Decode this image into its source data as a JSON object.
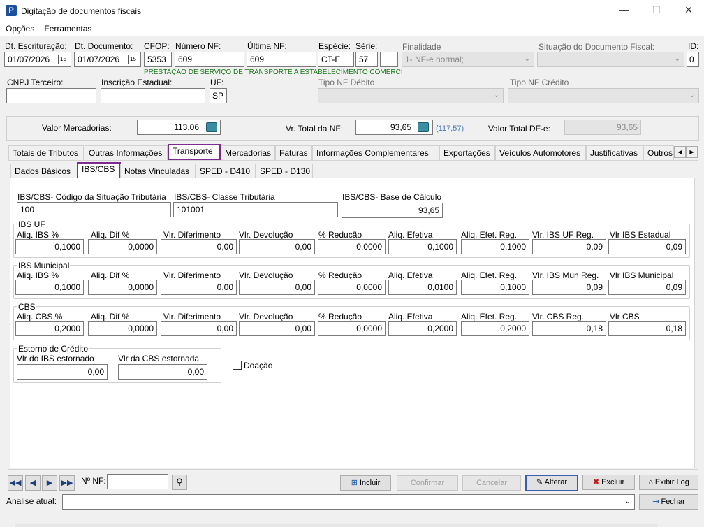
{
  "window": {
    "title": "Digitação de documentos fiscais"
  },
  "menu": [
    "Opções",
    "Ferramentas"
  ],
  "header": {
    "dt_escrituracao": {
      "label": "Dt. Escrituração:",
      "value": "01/07/2026"
    },
    "dt_documento": {
      "label": "Dt. Documento:",
      "value": "01/07/2026"
    },
    "cfop": {
      "label": "CFOP:",
      "value": "5353",
      "description": "PRESTAÇÃO DE SERVIÇO DE TRANSPORTE A ESTABELECIMENTO COMERCI"
    },
    "numero_nf": {
      "label": "Número NF:",
      "value": "609"
    },
    "ultima_nf": {
      "label": "Última NF:",
      "value": "609"
    },
    "especie": {
      "label": "Espécie:",
      "value": "CT-E"
    },
    "serie": {
      "label": "Série:",
      "value": "57",
      "extra": ""
    },
    "finalidade": {
      "label": "Finalidade",
      "value": "1- NF-e normal;"
    },
    "situacao": {
      "label": "Situação do Documento Fiscal:",
      "value": ""
    },
    "id": {
      "label": "ID:",
      "value": "0"
    },
    "cnpj": {
      "label": "CNPJ Terceiro:",
      "value": ""
    },
    "ie": {
      "label": "Inscrição Estadual:",
      "value": ""
    },
    "uf": {
      "label": "UF:",
      "value": "SP"
    },
    "tipo_debito": {
      "label": "Tipo NF Débito",
      "value": ""
    },
    "tipo_credito": {
      "label": "Tipo NF Crédito",
      "value": ""
    }
  },
  "totals": {
    "valor_mercadorias": {
      "label": "Valor Mercadorias:",
      "value": "113,06"
    },
    "vr_total_nf": {
      "label": "Vr. Total da NF:",
      "value": "93,65",
      "hint": "(117,57)"
    },
    "valor_total_dfe": {
      "label": "Valor Total DF-e:",
      "value": "93,65"
    }
  },
  "tabs": [
    "Totais de Tributos",
    "Outras Informações",
    "Transporte",
    "Mercadorias",
    "Faturas",
    "Informações Complementares",
    "Exportações",
    "Veículos Automotores",
    "Justificativas",
    "Outros"
  ],
  "subtabs": [
    "Dados Básicos",
    "IBS/CBS",
    "Notas Vinculadas",
    "SPED - D410",
    "SPED - D130"
  ],
  "ibscbs": {
    "cst": {
      "label": "IBS/CBS- Código da Situação Tributária",
      "value": "100"
    },
    "classe": {
      "label": "IBS/CBS- Classe Tributária",
      "value": "101001"
    },
    "base": {
      "label": "IBS/CBS- Base de Cálculo",
      "value": "93,65"
    }
  },
  "ibs_uf": {
    "title": "IBS UF",
    "labels": [
      "Aliq. IBS %",
      "Aliq. Dif %",
      "Vlr. Diferimento",
      "Vlr. Devolução",
      "% Redução",
      "Aliq. Efetiva",
      "Aliq. Efet. Reg.",
      "Vlr. IBS UF Reg.",
      "Vlr IBS Estadual"
    ],
    "values": [
      "0,1000",
      "0,0000",
      "0,00",
      "0,00",
      "0,0000",
      "0,1000",
      "0,1000",
      "0,09",
      "0,09"
    ]
  },
  "ibs_mun": {
    "title": "IBS Municipal",
    "labels": [
      "Aliq. IBS %",
      "Aliq. Dif %",
      "Vlr. Diferimento",
      "Vlr. Devolução",
      "% Redução",
      "Aliq. Efetiva",
      "Aliq. Efet. Reg.",
      "Vlr. IBS Mun Reg.",
      "Vlr IBS Municipal"
    ],
    "values": [
      "0,1000",
      "0,0000",
      "0,00",
      "0,00",
      "0,0000",
      "0,0100",
      "0,1000",
      "0,09",
      "0,09"
    ]
  },
  "cbs": {
    "title": "CBS",
    "labels": [
      "Aliq. CBS %",
      "Aliq. Dif %",
      "Vlr. Diferimento",
      "Vlr. Devolução",
      "% Redução",
      "Aliq. Efetiva",
      "Aliq. Efet. Reg.",
      "Vlr. CBS Reg.",
      "Vlr CBS"
    ],
    "values": [
      "0,2000",
      "0,0000",
      "0,00",
      "0,00",
      "0,0000",
      "0,2000",
      "0,2000",
      "0,18",
      "0,18"
    ]
  },
  "estorno": {
    "title": "Estorno de Crédito",
    "ibs_label": "Vlr do IBS estornado",
    "ibs_value": "0,00",
    "cbs_label": "Vlr da CBS estornada",
    "cbs_value": "0,00"
  },
  "doacao": {
    "label": "Doação",
    "checked": false
  },
  "footer": {
    "nf_label": "Nº NF:",
    "nf_value": "",
    "incluir": "Incluir",
    "confirmar": "Confirmar",
    "cancelar": "Cancelar",
    "alterar": "Alterar",
    "excluir": "Excluir",
    "exibir_log": "Exibir Log",
    "fechar": "Fechar",
    "analise_label": "Analise atual:",
    "analise_value": ""
  },
  "colors": {
    "tab_highlight": "#7e2b8f",
    "cfop_desc": "#1a7a1a",
    "hint": "#4a78b8"
  }
}
